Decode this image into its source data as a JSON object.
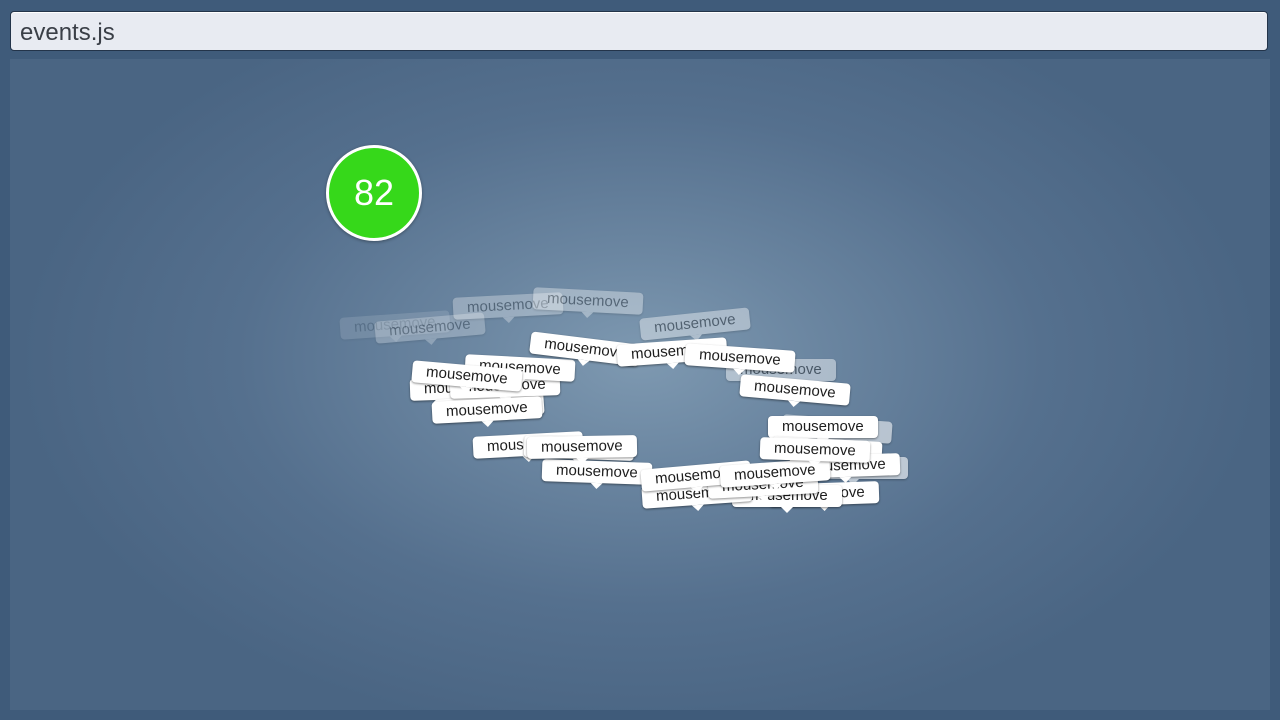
{
  "window": {
    "title": "events.js"
  },
  "score": {
    "value": "82"
  },
  "tooltips": [
    {
      "label": "mousemove"
    },
    {
      "label": "mousemove"
    },
    {
      "label": "mousemove"
    },
    {
      "label": "mousemove"
    },
    {
      "label": "mousemove"
    },
    {
      "label": "mousemove"
    },
    {
      "label": "mousemove"
    },
    {
      "label": "mousemove"
    },
    {
      "label": "mousemove"
    },
    {
      "label": "mousemove"
    },
    {
      "label": "mousemove"
    },
    {
      "label": "mousemove"
    },
    {
      "label": "mousemove"
    },
    {
      "label": "mousemove"
    },
    {
      "label": "mousemove"
    },
    {
      "label": "mousemove"
    },
    {
      "label": "mousemove"
    },
    {
      "label": "mousemove"
    },
    {
      "label": "mousemove"
    },
    {
      "label": "mousemove"
    },
    {
      "label": "mousemove"
    },
    {
      "label": "mousemove"
    },
    {
      "label": "mousemove"
    },
    {
      "label": "mousemove"
    },
    {
      "label": "mousemove"
    },
    {
      "label": "mousemove"
    },
    {
      "label": "mousemove"
    },
    {
      "label": "mousemove"
    },
    {
      "label": "mousemove"
    },
    {
      "label": "mousemove"
    },
    {
      "label": "mousemove"
    },
    {
      "label": "mousemove"
    }
  ],
  "colors": {
    "score_bg": "#36d81a",
    "stage": "#6a85a0",
    "tooltip_bg": "#ffffff"
  }
}
